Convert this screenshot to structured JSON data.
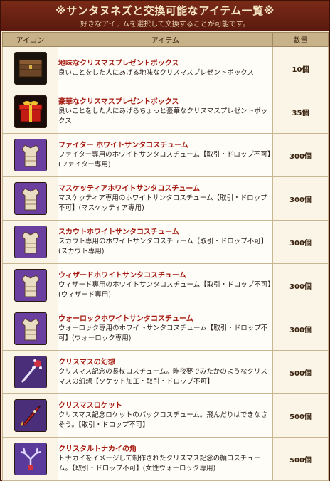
{
  "header": {
    "title": "※サンタヌネズと交換可能なアイテム一覧※",
    "subtitle": "好きなアイテムを選択して交換することが可能です。"
  },
  "columns": {
    "icon": "アイコン",
    "item": "アイテム",
    "quantity": "数量"
  },
  "items": [
    {
      "icon": "chest-icon",
      "name": "地味なクリスマスプレゼントボックス",
      "desc": "良いことをした人にあげる地味なクリスマスプレゼントボックス",
      "qty": "10個"
    },
    {
      "icon": "gift-box-icon",
      "name": "豪華なクリスマスプレゼントボックス",
      "desc": "良いことをした人にあげるちょっと豪華なクリスマスプレゼントボックス",
      "qty": "35個"
    },
    {
      "icon": "costume-icon",
      "name": "ファイター ホワイトサンタコスチューム",
      "desc": "ファイター専用のホワイトサンタコスチューム【取引・ドロップ不可】(ファイター専用)",
      "qty": "300個"
    },
    {
      "icon": "costume-icon",
      "name": "マスケッティアホワイトサンタコスチューム",
      "desc": "マスケッティア専用のホワイトサンタコスチューム【取引・ドロップ不可】(マスケッティア専用)",
      "qty": "300個"
    },
    {
      "icon": "costume-icon",
      "name": "スカウトホワイトサンタコスチューム",
      "desc": "スカウト専用のホワイトサンタコスチューム【取引・ドロップ不可】(スカウト専用)",
      "qty": "300個"
    },
    {
      "icon": "costume-icon",
      "name": "ウィザードホワイトサンタコスチューム",
      "desc": "ウィザード専用のホワイトサンタコスチューム【取引・ドロップ不可】(ウィザード専用)",
      "qty": "300個"
    },
    {
      "icon": "costume-icon",
      "name": "ウォーロックホワイトサンタコスチューム",
      "desc": "ウォーロック専用のホワイトサンタコスチューム【取引・ドロップ不可】(ウォーロック専用)",
      "qty": "300個"
    },
    {
      "icon": "fantasy-weapon-icon",
      "name": "クリスマスの幻想",
      "desc": "クリスマス記念の長杖コスチューム。昨夜夢でみたかのようなクリスマスの幻想【ソケット加工・取引・ドロップ不可】",
      "qty": "500個"
    },
    {
      "icon": "rocket-icon",
      "name": "クリスマスロケット",
      "desc": "クリスマス記念ロケットのバックコスチューム。飛んだりはできなさそう。【取引・ドロップ不可】",
      "qty": "500個"
    },
    {
      "icon": "reindeer-antler-icon",
      "name": "クリスタルトナカイの角",
      "desc": "トナカイをイメージして制作されたクリスマス記念の顔コスチューム。【取引・ドロップ不可】(女性ウォーロック専用)",
      "qty": "500個"
    }
  ]
}
